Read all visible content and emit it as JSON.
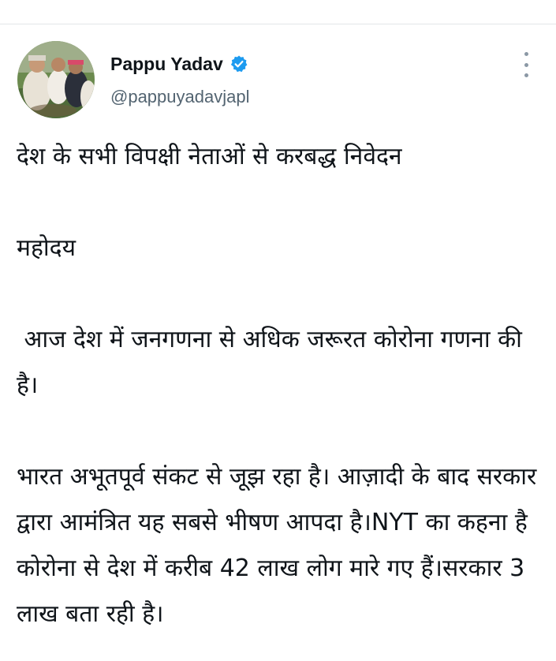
{
  "author": {
    "display_name": "Pappu Yadav",
    "handle": "@pappuyadavjapl",
    "verified": true,
    "verified_badge_color": "#1d9bf0"
  },
  "menu": {
    "icon": "more-vertical-icon"
  },
  "tweet": {
    "paragraphs": [
      "देश के सभी विपक्षी नेताओं से करबद्ध निवेदन",
      "महोदय",
      " आज देश में जनगणना से अधिक जरूरत कोरोना गणना की है।",
      "भारत अभूतपूर्व संकट से जूझ रहा है। आज़ादी के बाद सरकार द्वारा आमंत्रित यह सबसे भीषण आपदा है।NYT का कहना है कोरोना से देश में करीब 42 लाख लोग मारे गए हैं।सरकार 3 लाख बता रही है।"
    ]
  },
  "colors": {
    "text": "#0f1419",
    "secondary_text": "#536471",
    "divider": "#e3e6e8"
  }
}
